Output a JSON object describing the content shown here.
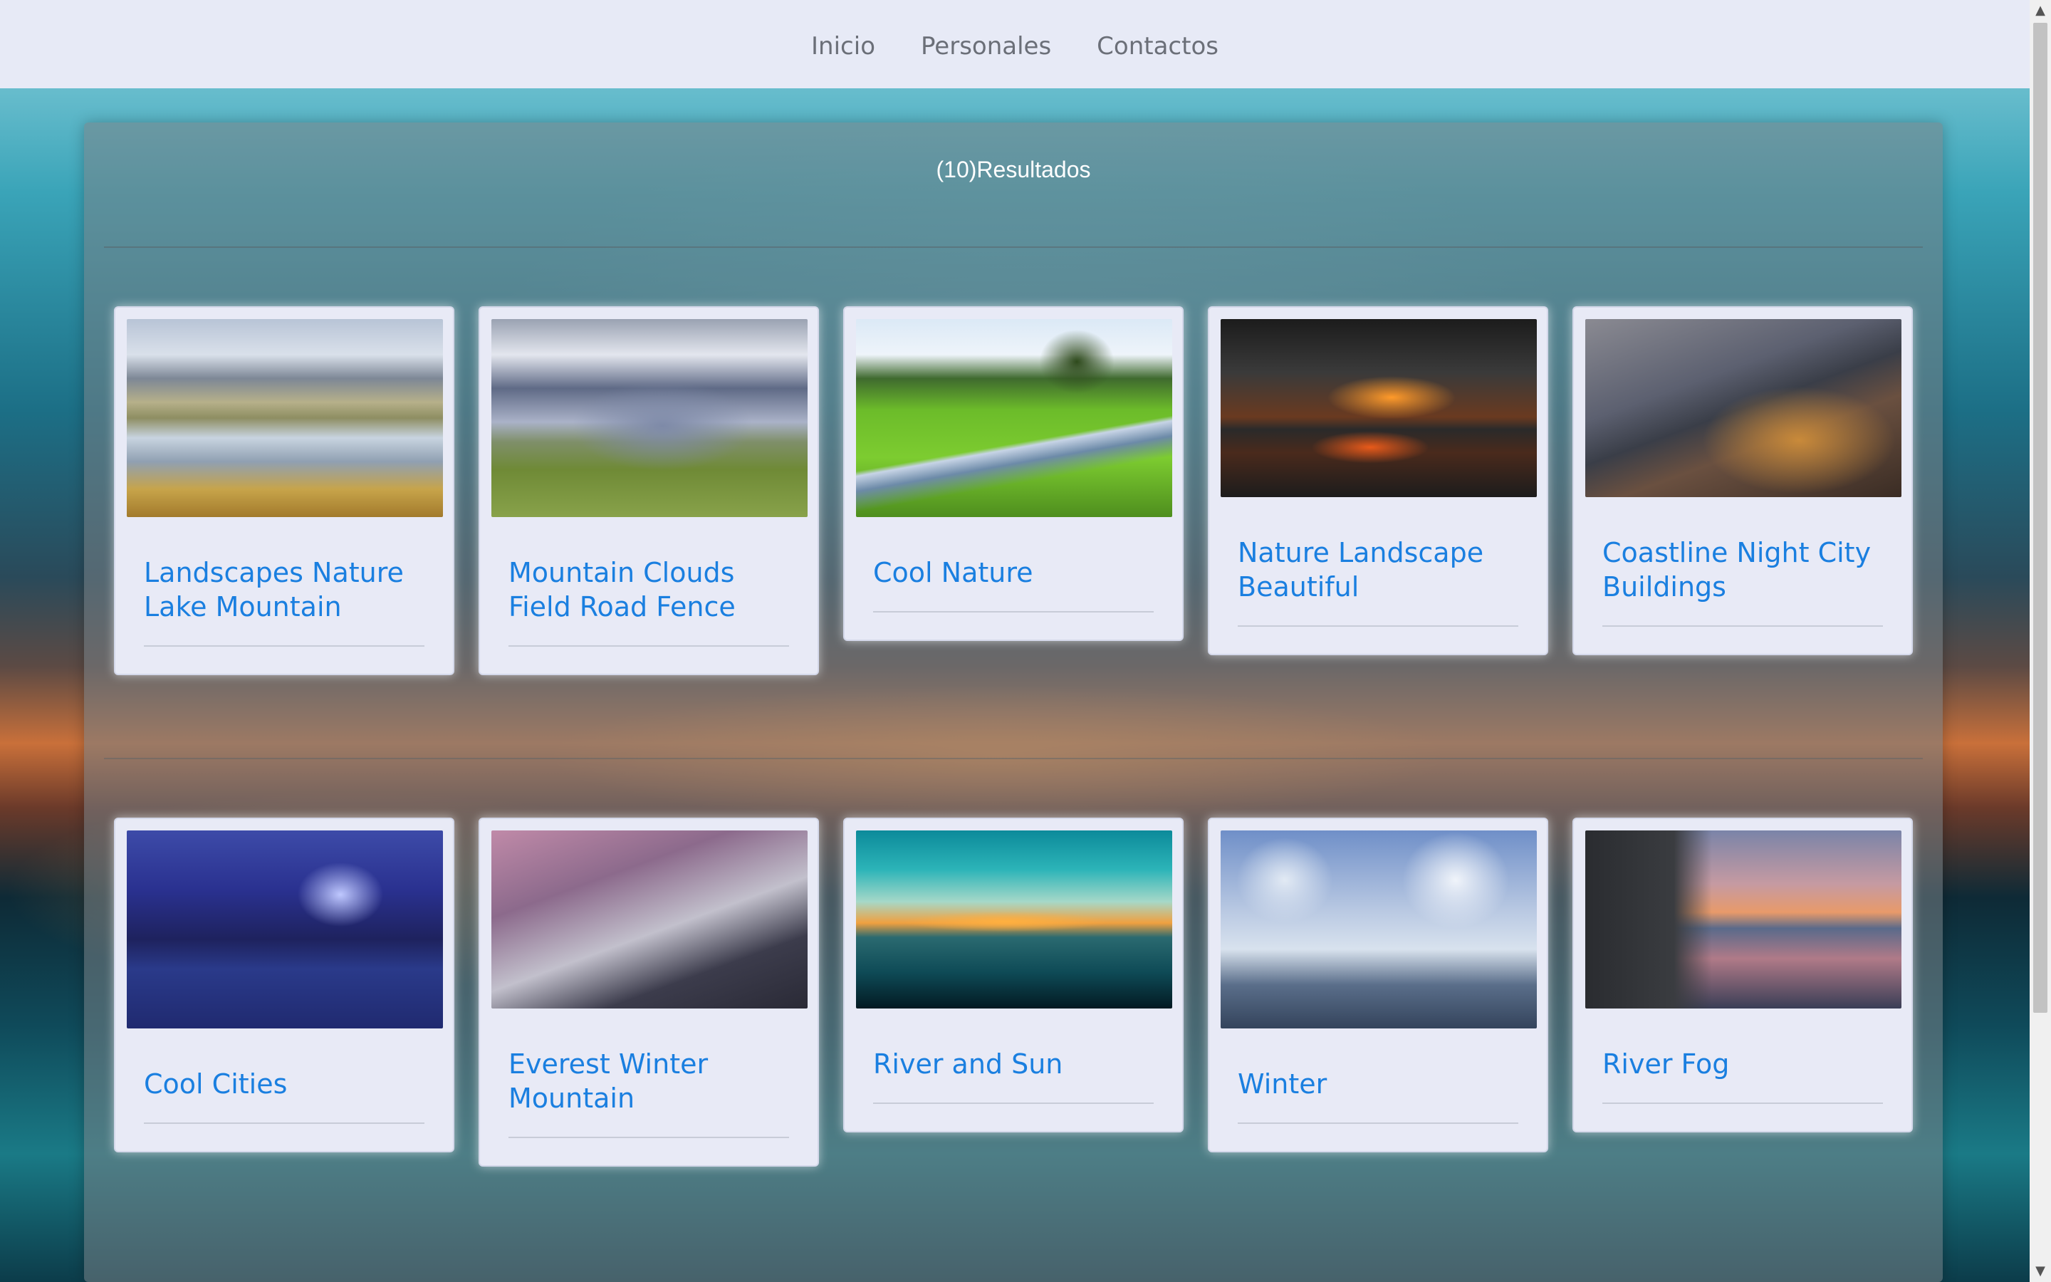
{
  "nav": {
    "items": [
      {
        "label": "Inicio"
      },
      {
        "label": "Personales"
      },
      {
        "label": "Contactos"
      }
    ]
  },
  "results": {
    "title": "(10)Resultados"
  },
  "cards": [
    {
      "title": "Landscapes Nature Lake Mountain",
      "image": "lake-mountain-photo"
    },
    {
      "title": "Mountain Clouds Field Road Fence",
      "image": "mountain-clouds-photo"
    },
    {
      "title": "Cool Nature",
      "image": "stream-meadow-photo"
    },
    {
      "title": "Nature Landscape Beautiful",
      "image": "sunset-lake-photo"
    },
    {
      "title": "Coastline Night City Buildings",
      "image": "coastline-night-city-photo"
    },
    {
      "title": "Cool Cities",
      "image": "city-night-photo"
    },
    {
      "title": "Everest Winter Mountain",
      "image": "everest-winter-photo"
    },
    {
      "title": "River and Sun",
      "image": "river-sunset-photo"
    },
    {
      "title": "Winter",
      "image": "winter-bridge-photo"
    },
    {
      "title": "River Fog",
      "image": "river-fog-photo"
    }
  ],
  "colors": {
    "navbar_bg": "#e7eaf6",
    "card_bg": "#e8eaf6",
    "card_title": "#1a7fe0",
    "nav_link": "#6b6f78"
  }
}
